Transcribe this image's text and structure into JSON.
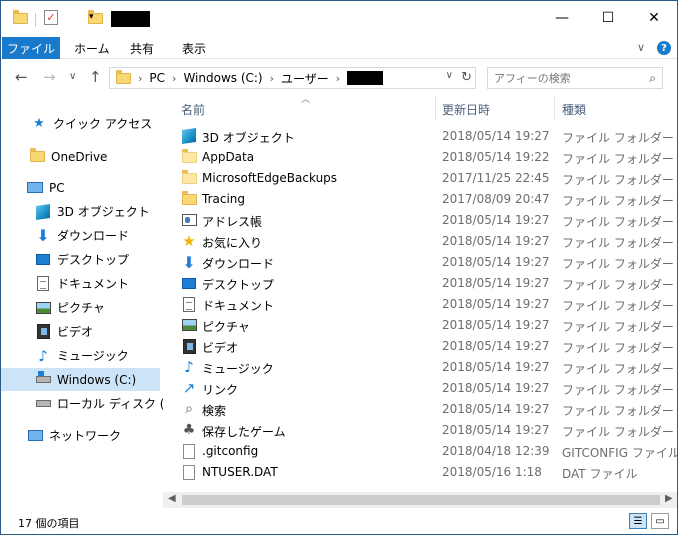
{
  "titlebar": {
    "minimize": "—",
    "maximize": "☐",
    "close": "✕"
  },
  "ribbon": {
    "tabs": [
      "ファイル",
      "ホーム",
      "共有",
      "表示"
    ],
    "chevron": "∨",
    "help": "?"
  },
  "nav": {
    "back": "←",
    "forward": "→",
    "history": "∨",
    "up": "↑"
  },
  "address": {
    "crumbs": [
      "PC",
      "Windows (C:)",
      "ユーザー"
    ],
    "dropdown": "∨",
    "refresh": "↻"
  },
  "search": {
    "placeholder": "アフィーの検索",
    "icon": "magnifier-icon"
  },
  "navpane": {
    "items": [
      {
        "label": "クイック アクセス",
        "icon": "star-icon"
      },
      {
        "label": "OneDrive",
        "icon": "folder-icon"
      },
      {
        "label": "PC",
        "icon": "pc-icon"
      },
      {
        "label": "3D オブジェクト",
        "icon": "3d-objects-icon"
      },
      {
        "label": "ダウンロード",
        "icon": "download-icon"
      },
      {
        "label": "デスクトップ",
        "icon": "desktop-icon"
      },
      {
        "label": "ドキュメント",
        "icon": "document-icon"
      },
      {
        "label": "ピクチャ",
        "icon": "pictures-icon"
      },
      {
        "label": "ビデオ",
        "icon": "video-icon"
      },
      {
        "label": "ミュージック",
        "icon": "music-icon"
      },
      {
        "label": "Windows (C:)",
        "icon": "windows-drive-icon"
      },
      {
        "label": "ローカル ディスク (D:)",
        "icon": "drive-icon"
      },
      {
        "label": "ネットワーク",
        "icon": "network-icon"
      }
    ]
  },
  "filelist": {
    "columns": [
      "名前",
      "更新日時",
      "種類"
    ],
    "rows": [
      {
        "name": "3D オブジェクト",
        "date": "2018/05/14 19:27",
        "type": "ファイル フォルダー",
        "icon": "3d-objects-icon"
      },
      {
        "name": "AppData",
        "date": "2018/05/14 19:22",
        "type": "ファイル フォルダー",
        "icon": "folder-icon"
      },
      {
        "name": "MicrosoftEdgeBackups",
        "date": "2017/11/25 22:45",
        "type": "ファイル フォルダー",
        "icon": "folder-icon"
      },
      {
        "name": "Tracing",
        "date": "2017/08/09 20:47",
        "type": "ファイル フォルダー",
        "icon": "folder-icon"
      },
      {
        "name": "アドレス帳",
        "date": "2018/05/14 19:27",
        "type": "ファイル フォルダー",
        "icon": "contacts-icon"
      },
      {
        "name": "お気に入り",
        "date": "2018/05/14 19:27",
        "type": "ファイル フォルダー",
        "icon": "favorites-icon"
      },
      {
        "name": "ダウンロード",
        "date": "2018/05/14 19:27",
        "type": "ファイル フォルダー",
        "icon": "download-icon"
      },
      {
        "name": "デスクトップ",
        "date": "2018/05/14 19:27",
        "type": "ファイル フォルダー",
        "icon": "desktop-icon"
      },
      {
        "name": "ドキュメント",
        "date": "2018/05/14 19:27",
        "type": "ファイル フォルダー",
        "icon": "document-icon"
      },
      {
        "name": "ピクチャ",
        "date": "2018/05/14 19:27",
        "type": "ファイル フォルダー",
        "icon": "pictures-icon"
      },
      {
        "name": "ビデオ",
        "date": "2018/05/14 19:27",
        "type": "ファイル フォルダー",
        "icon": "video-icon"
      },
      {
        "name": "ミュージック",
        "date": "2018/05/14 19:27",
        "type": "ファイル フォルダー",
        "icon": "music-icon"
      },
      {
        "name": "リンク",
        "date": "2018/05/14 19:27",
        "type": "ファイル フォルダー",
        "icon": "links-icon"
      },
      {
        "name": "検索",
        "date": "2018/05/14 19:27",
        "type": "ファイル フォルダー",
        "icon": "search-icon"
      },
      {
        "name": "保存したゲーム",
        "date": "2018/05/14 19:27",
        "type": "ファイル フォルダー",
        "icon": "saved-games-icon"
      },
      {
        "name": ".gitconfig",
        "date": "2018/04/18 12:39",
        "type": "GITCONFIG ファイル",
        "icon": "file-icon"
      },
      {
        "name": "NTUSER.DAT",
        "date": "2018/05/16 1:18",
        "type": "DAT ファイル",
        "icon": "file-icon"
      }
    ]
  },
  "scrollbar": {
    "left": "◀",
    "right": "▶"
  },
  "status": {
    "text": "17 個の項目"
  },
  "colors": {
    "accent": "#1979ca",
    "selected": "#cce4f7"
  }
}
